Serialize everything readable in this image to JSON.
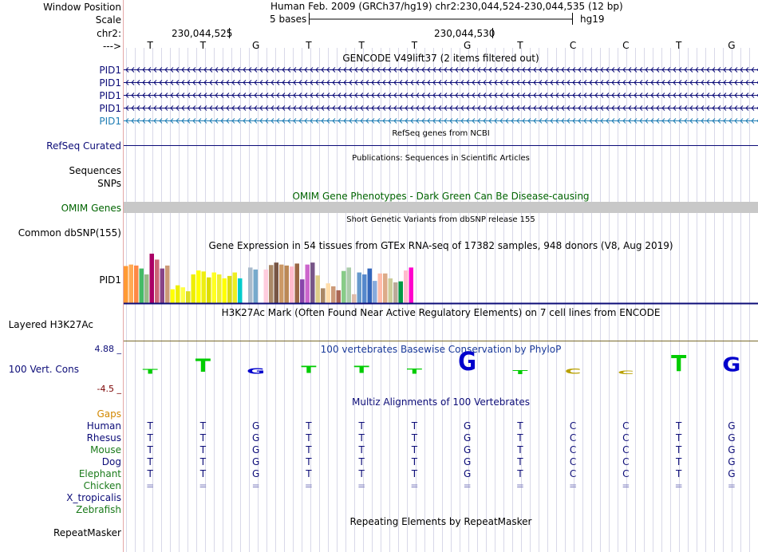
{
  "header": {
    "window_position_label": "Window Position",
    "scale_label": "Scale",
    "chr_label": "chr2:",
    "arrow_label": "--->",
    "assembly_and_position": "Human Feb. 2009 (GRCh37/hg19)   chr2:230,044,524-230,044,535 (12 bp)",
    "scale_text": "5 bases",
    "scale_db": "hg19",
    "coord_left": "230,044,525",
    "coord_right": "230,044,530",
    "bases": [
      "T",
      "T",
      "G",
      "T",
      "T",
      "T",
      "G",
      "T",
      "C",
      "C",
      "T",
      "G"
    ]
  },
  "tracks": {
    "gencode": {
      "title": "GENCODE V49lift37 (2 items filtered out)",
      "items": [
        "PID1",
        "PID1",
        "PID1",
        "PID1",
        "PID1"
      ],
      "item_colors": [
        "#0c0c78",
        "#0c0c78",
        "#0c0c78",
        "#0c0c78",
        "#1e7db4"
      ]
    },
    "refseq": {
      "title": "RefSeq genes from NCBI",
      "label": "RefSeq Curated",
      "color": "#0c0c78"
    },
    "publications": {
      "title": "Publications: Sequences in Scientific Articles",
      "labels": [
        "Sequences",
        "SNPs"
      ]
    },
    "omim": {
      "title": "OMIM Gene Phenotypes - Dark Green Can Be Disease-causing",
      "label": "OMIM Genes",
      "color": "#006400"
    },
    "dbsnp": {
      "title": "Short Genetic Variants from dbSNP release 155",
      "label": "Common dbSNP(155)"
    },
    "gtex": {
      "title": "Gene Expression in 54 tissues from GTEx RNA-seq of 17382 samples, 948 donors (V8, Aug 2019)",
      "label": "PID1",
      "bar_levels": [
        0.75,
        0.78,
        0.76,
        0.7,
        0.58,
        1.0,
        0.88,
        0.7,
        0.76,
        0.28,
        0.36,
        0.32,
        0.24,
        0.58,
        0.66,
        0.64,
        0.52,
        0.62,
        0.58,
        0.5,
        0.55,
        0.62,
        0.5,
        0.55,
        0.72,
        0.68,
        0.0,
        0.68,
        0.77,
        0.82,
        0.78,
        0.76,
        0.74,
        0.8,
        0.48,
        0.78,
        0.82,
        0.56,
        0.3,
        0.4,
        0.34,
        0.26,
        0.65,
        0.72,
        0.18,
        0.62,
        0.58,
        0.7,
        0.45,
        0.6,
        0.6,
        0.5,
        0.42,
        0.44,
        0.66,
        0.72,
        0.22,
        0.02
      ],
      "bar_colors": [
        "#ff9933",
        "#ffaa55",
        "#ff8844",
        "#44bb66",
        "#99bb88",
        "#aa0066",
        "#cc6677",
        "#884488",
        "#cc9977",
        "#ffff00",
        "#eeee00",
        "#ffff44",
        "#dddd22",
        "#eeee00",
        "#ffff00",
        "#eeee11",
        "#dddd00",
        "#ffff22",
        "#eeee33",
        "#ffff00",
        "#dddd11",
        "#eeee22",
        "#00cccc",
        "#ffffff",
        "#aabbcc",
        "#77aacc",
        "#ddbbcc",
        "#ffccdd",
        "#aa8866",
        "#775544",
        "#cc9966",
        "#bb8855",
        "#ffbbcc",
        "#996644",
        "#8844aa",
        "#cc66cc",
        "#775588",
        "#ddcc88",
        "#aa8866",
        "#ffddaa",
        "#cc9977",
        "#aa6655",
        "#88cc88",
        "#aaccaa",
        "#ddbbaa",
        "#6699cc",
        "#5588cc",
        "#3366bb",
        "#88aadd",
        "#ffbbaa",
        "#ddaa88",
        "#cccc99",
        "#bbaa99",
        "#009944",
        "#ffbbcc",
        "#ff00cc"
      ]
    },
    "h3k27ac": {
      "title": "H3K27Ac Mark (Often Found Near Active Regulatory Elements) on 7 cell lines from ENCODE",
      "label": "Layered H3K27Ac"
    },
    "conservation": {
      "title": "100 vertebrates Basewise Conservation by PhyloP",
      "label": "100 Vert. Cons",
      "y_max": "4.88 _",
      "y_min": "-4.5 _",
      "scores": [
        0.55,
        1.6,
        -0.7,
        0.9,
        0.9,
        0.6,
        2.3,
        0.5,
        -0.6,
        -0.45,
        2.0,
        -1.8
      ]
    },
    "multiz": {
      "title": "Multiz Alignments of 100 Vertebrates",
      "gaps_label": "Gaps",
      "species": [
        {
          "name": "Human",
          "color": "#0c0c78",
          "seq": [
            "T",
            "T",
            "G",
            "T",
            "T",
            "T",
            "G",
            "T",
            "C",
            "C",
            "T",
            "G"
          ]
        },
        {
          "name": "Rhesus",
          "color": "#0c0c78",
          "seq": [
            "T",
            "T",
            "G",
            "T",
            "T",
            "T",
            "G",
            "T",
            "C",
            "C",
            "T",
            "G"
          ]
        },
        {
          "name": "Mouse",
          "color": "#1a7a1a",
          "seq": [
            "T",
            "T",
            "G",
            "T",
            "T",
            "T",
            "G",
            "T",
            "C",
            "C",
            "T",
            "G"
          ]
        },
        {
          "name": "Dog",
          "color": "#0c0c78",
          "seq": [
            "T",
            "T",
            "G",
            "T",
            "T",
            "T",
            "G",
            "T",
            "C",
            "C",
            "T",
            "G"
          ]
        },
        {
          "name": "Elephant",
          "color": "#1a7a1a",
          "seq": [
            "T",
            "T",
            "G",
            "T",
            "T",
            "T",
            "G",
            "T",
            "C",
            "C",
            "T",
            "G"
          ]
        },
        {
          "name": "Chicken",
          "color": "#1a7a1a",
          "seq": [
            "=",
            "=",
            "=",
            "=",
            "=",
            "=",
            "=",
            "=",
            "=",
            "=",
            "=",
            "="
          ]
        },
        {
          "name": "X_tropicalis",
          "color": "#0c0c78",
          "seq": []
        },
        {
          "name": "Zebrafish",
          "color": "#1a7a1a",
          "seq": []
        }
      ]
    },
    "repeatmasker": {
      "title": "Repeating Elements by RepeatMasker",
      "label": "RepeatMasker"
    }
  },
  "colors": {
    "omim_bar": "#c8c8c8",
    "grid_line": "#d8d8e8",
    "label_blue": "#0c0c78",
    "gaps_orange": "#d28800",
    "cons_pos": "#00cc00",
    "cons_neg": "#0000cc",
    "cons_gold": "#b8a000"
  }
}
